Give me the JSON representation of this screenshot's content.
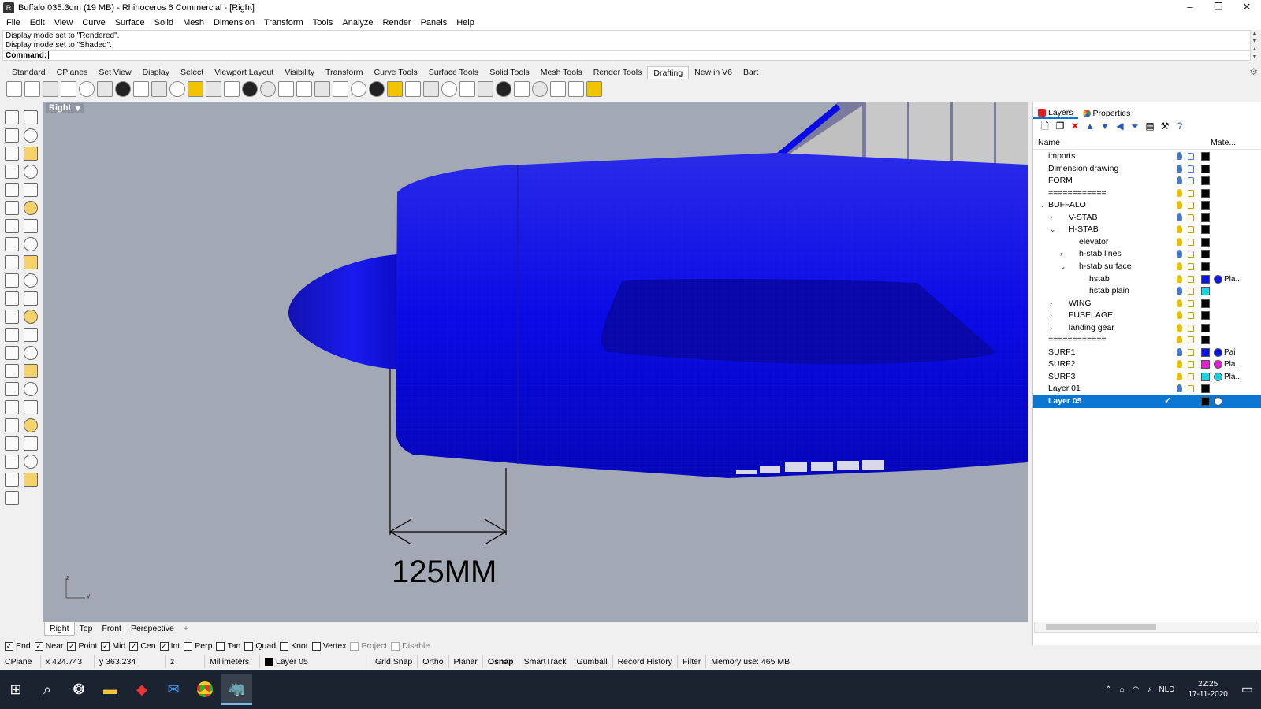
{
  "window": {
    "title": "Buffalo 035.3dm (19 MB) - Rhinoceros 6 Commercial - [Right]"
  },
  "menu": [
    "File",
    "Edit",
    "View",
    "Curve",
    "Surface",
    "Solid",
    "Mesh",
    "Dimension",
    "Transform",
    "Tools",
    "Analyze",
    "Render",
    "Panels",
    "Help"
  ],
  "command": {
    "history": [
      "Display mode set to \"Rendered\".",
      "Display mode set to \"Shaded\"."
    ],
    "prompt": "Command:"
  },
  "toolbar_tabs": [
    "Standard",
    "CPlanes",
    "Set View",
    "Display",
    "Select",
    "Viewport Layout",
    "Visibility",
    "Transform",
    "Curve Tools",
    "Surface Tools",
    "Solid Tools",
    "Mesh Tools",
    "Render Tools",
    "Drafting",
    "New in V6",
    "Bart"
  ],
  "active_toolbar_tab": "Drafting",
  "viewport": {
    "name": "Right",
    "dimension_text": "125MM",
    "axis_z": "z",
    "axis_y": "y",
    "model_color": "#0a0adc"
  },
  "viewport_tabs": [
    "Right",
    "Top",
    "Front",
    "Perspective"
  ],
  "active_viewport_tab": "Right",
  "osnaps": [
    {
      "label": "End",
      "checked": true
    },
    {
      "label": "Near",
      "checked": true
    },
    {
      "label": "Point",
      "checked": true
    },
    {
      "label": "Mid",
      "checked": true
    },
    {
      "label": "Cen",
      "checked": true
    },
    {
      "label": "Int",
      "checked": true
    },
    {
      "label": "Perp",
      "checked": false
    },
    {
      "label": "Tan",
      "checked": false
    },
    {
      "label": "Quad",
      "checked": false
    },
    {
      "label": "Knot",
      "checked": false
    },
    {
      "label": "Vertex",
      "checked": false
    },
    {
      "label": "Project",
      "checked": false,
      "disabled": true
    },
    {
      "label": "Disable",
      "checked": false,
      "disabled": true
    }
  ],
  "status": {
    "cplane": "CPlane",
    "x": "x 424.743",
    "y": "y 363.234",
    "z": "z",
    "units": "Millimeters",
    "layer": "Layer 05",
    "grid_snap": "Grid Snap",
    "ortho": "Ortho",
    "planar": "Planar",
    "osnap": "Osnap",
    "smarttrack": "SmartTrack",
    "gumball": "Gumball",
    "record_history": "Record History",
    "filter": "Filter",
    "memory": "Memory use: 465 MB"
  },
  "panel": {
    "tabs": [
      "Layers",
      "Properties"
    ],
    "col_name": "Name",
    "col_material": "Mate...",
    "layers": [
      {
        "name": "imports",
        "indent": 0,
        "bulb": "#4a78c8",
        "locked": true,
        "color": "#000000"
      },
      {
        "name": "Dimension drawing",
        "indent": 0,
        "bulb": "#4a78c8",
        "locked": true,
        "color": "#000000"
      },
      {
        "name": "FORM",
        "indent": 0,
        "bulb": "#4a78c8",
        "locked": true,
        "color": "#000000"
      },
      {
        "name": "============",
        "indent": 0,
        "bulb": "#e8c000",
        "locked": false,
        "color": "#000000"
      },
      {
        "name": "BUFFALO",
        "indent": 0,
        "expander": "⌄",
        "bulb": "#e8c000",
        "locked": false,
        "color": "#000000"
      },
      {
        "name": "V-STAB",
        "indent": 1,
        "expander": "›",
        "bulb": "#4a78c8",
        "locked": false,
        "color": "#000000"
      },
      {
        "name": "H-STAB",
        "indent": 1,
        "expander": "⌄",
        "bulb": "#e8c000",
        "locked": false,
        "color": "#000000"
      },
      {
        "name": "elevator",
        "indent": 2,
        "bulb": "#e8c000",
        "locked": false,
        "color": "#000000"
      },
      {
        "name": "h-stab lines",
        "indent": 2,
        "expander": "›",
        "bulb": "#4a78c8",
        "locked": false,
        "color": "#000000"
      },
      {
        "name": "h-stab surface",
        "indent": 2,
        "expander": "⌄",
        "bulb": "#e8c000",
        "locked": false,
        "color": "#000000"
      },
      {
        "name": "hstab",
        "indent": 3,
        "bulb": "#e8c000",
        "locked": false,
        "color": "#0a14e6",
        "material": "#0a14e6",
        "material_label": "Pla..."
      },
      {
        "name": "hstab plain",
        "indent": 3,
        "bulb": "#4a78c8",
        "locked": false,
        "color": "#16d6e6"
      },
      {
        "name": "WING",
        "indent": 1,
        "expander": "›",
        "bulb": "#e8c000",
        "locked": false,
        "color": "#000000"
      },
      {
        "name": "FUSELAGE",
        "indent": 1,
        "expander": "›",
        "bulb": "#e8c000",
        "locked": false,
        "color": "#000000"
      },
      {
        "name": "landing gear",
        "indent": 1,
        "expander": "›",
        "bulb": "#e8c000",
        "locked": false,
        "color": "#000000"
      },
      {
        "name": "============",
        "indent": 0,
        "bulb": "#e8c000",
        "locked": false,
        "color": "#000000"
      },
      {
        "name": "SURF1",
        "indent": 0,
        "bulb": "#4a78c8",
        "locked": false,
        "color": "#0a14e6",
        "material": "#0a14e6",
        "material_label": "Pai"
      },
      {
        "name": "SURF2",
        "indent": 0,
        "bulb": "#e8c000",
        "locked": false,
        "color": "#e61ed2",
        "material": "#e61ed2",
        "material_label": "Pla..."
      },
      {
        "name": "SURF3",
        "indent": 0,
        "bulb": "#e8c000",
        "locked": false,
        "color": "#16d6e6",
        "material": "#16d6e6",
        "material_label": "Pla..."
      },
      {
        "name": "Layer 01",
        "indent": 0,
        "bulb": "#4a78c8",
        "locked": false,
        "color": "#000000"
      },
      {
        "name": "Layer 05",
        "indent": 0,
        "bulb": "#ffffff",
        "locked": false,
        "color": "#000000",
        "material": "#ffffff",
        "current": true,
        "selected": true
      }
    ]
  },
  "taskbar": {
    "lang": "NLD",
    "time": "22:25",
    "date": "17-11-2020"
  }
}
